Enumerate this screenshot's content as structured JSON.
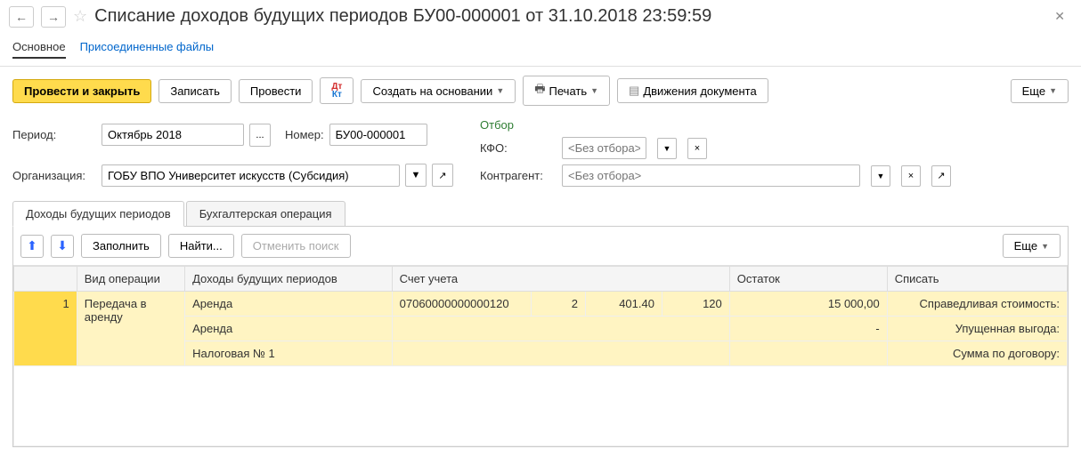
{
  "title": "Списание доходов будущих периодов БУ00-000001 от 31.10.2018 23:59:59",
  "topTabs": {
    "main": "Основное",
    "files": "Присоединенные файлы"
  },
  "toolbar": {
    "postClose": "Провести и закрыть",
    "save": "Записать",
    "post": "Провести",
    "createBased": "Создать на основании",
    "print": "Печать",
    "movements": "Движения документа",
    "more": "Еще"
  },
  "form": {
    "periodLabel": "Период:",
    "periodValue": "Октябрь 2018",
    "numberLabel": "Номер:",
    "numberValue": "БУ00-000001",
    "orgLabel": "Организация:",
    "orgValue": "ГОБУ ВПО Университет искусств (Субсидия)"
  },
  "filter": {
    "title": "Отбор",
    "kfoLabel": "КФО:",
    "contragentLabel": "Контрагент:",
    "placeholder": "<Без отбора>"
  },
  "subTabs": {
    "income": "Доходы будущих периодов",
    "accounting": "Бухгалтерская операция"
  },
  "tableToolbar": {
    "fill": "Заполнить",
    "find": "Найти...",
    "cancelFind": "Отменить поиск",
    "more": "Еще"
  },
  "columns": {
    "num": "",
    "opType": "Вид операции",
    "income": "Доходы будущих периодов",
    "account": "Счет учета",
    "balance": "Остаток",
    "writeoff": "Списать"
  },
  "row": {
    "num": "1",
    "opType": "Передача в аренду",
    "income1": "Аренда",
    "income2": "Аренда",
    "income3": "Налоговая № 1",
    "acct1": "07060000000000120",
    "acct2": "2",
    "acct3": "401.40",
    "acct4": "120",
    "balance": "15 000,00",
    "wo1": "Справедливая стоимость:",
    "wo2": "Упущенная выгода:",
    "wo3": "Сумма по договору:",
    "dash": "-"
  }
}
